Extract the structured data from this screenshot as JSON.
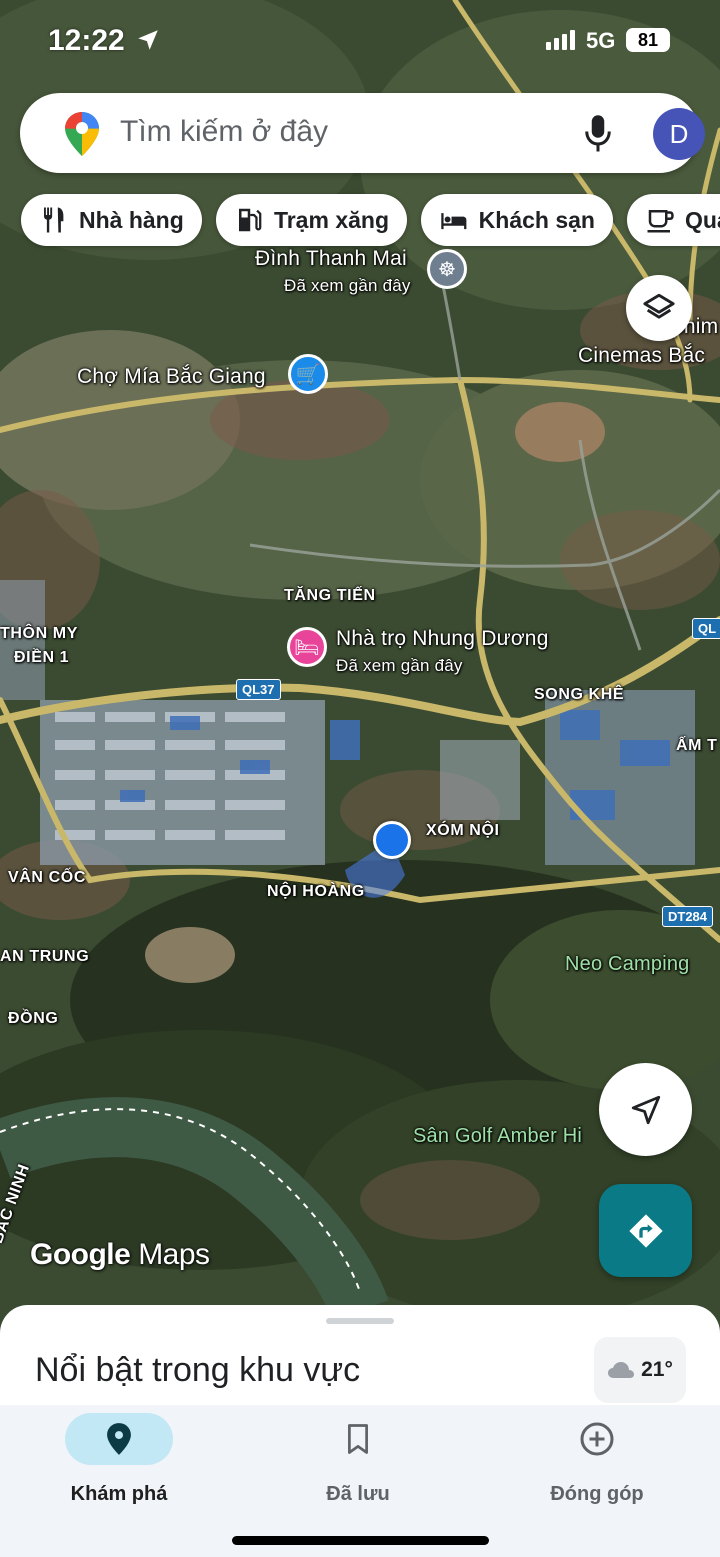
{
  "status_bar": {
    "time": "12:22",
    "network": "5G",
    "battery": "81"
  },
  "search": {
    "placeholder": "Tìm kiếm ở đây",
    "avatar_letter": "D"
  },
  "chips": [
    {
      "label": "Nhà hàng",
      "icon": "fork-knife-icon"
    },
    {
      "label": "Trạm xăng",
      "icon": "gas-station-icon"
    },
    {
      "label": "Khách sạn",
      "icon": "bed-icon"
    },
    {
      "label": "Quá",
      "icon": "coffee-cup-icon"
    }
  ],
  "map": {
    "places": {
      "dinh_thanh_mai": "Đình Thanh Mai",
      "dinh_thanh_mai_sub": "Đã xem gần đây",
      "cinemas_1": "phim",
      "cinemas_2": "Cinemas Bắc",
      "cho_mia": "Chợ Mía Bắc Giang",
      "tang_tien": "TĂNG TIẾN",
      "thon_my": "THÔN MY",
      "dien_1": "ĐIỀN 1",
      "nha_tro": "Nhà trọ Nhung Dương",
      "nha_tro_sub": "Đã xem gần đây",
      "song_khe": "SONG KHÊ",
      "am_t": "ẤM T",
      "xom_noi": "XÓM NỘI",
      "van_coc": "VÂN CỐC",
      "noi_hoang": "NỘI HOÀNG",
      "an_trung": "AN TRUNG",
      "dong": "ĐỒNG",
      "neo_camping": "Neo Camping",
      "san_golf": "Sân Golf Amber Hi",
      "bac_ninh": "BẮC NINH"
    },
    "road_shields": {
      "ql37": "QL37",
      "ql_right": "QL",
      "dt284": "DT284"
    },
    "brand": {
      "google": "Google",
      "maps": "Maps"
    }
  },
  "sheet": {
    "title": "Nổi bật trong khu vực",
    "temperature": "21°"
  },
  "nav": [
    {
      "label": "Khám phá",
      "icon": "explore-pin-icon",
      "active": true
    },
    {
      "label": "Đã lưu",
      "icon": "bookmark-icon",
      "active": false
    },
    {
      "label": "Đóng góp",
      "icon": "add-circle-icon",
      "active": false
    }
  ]
}
